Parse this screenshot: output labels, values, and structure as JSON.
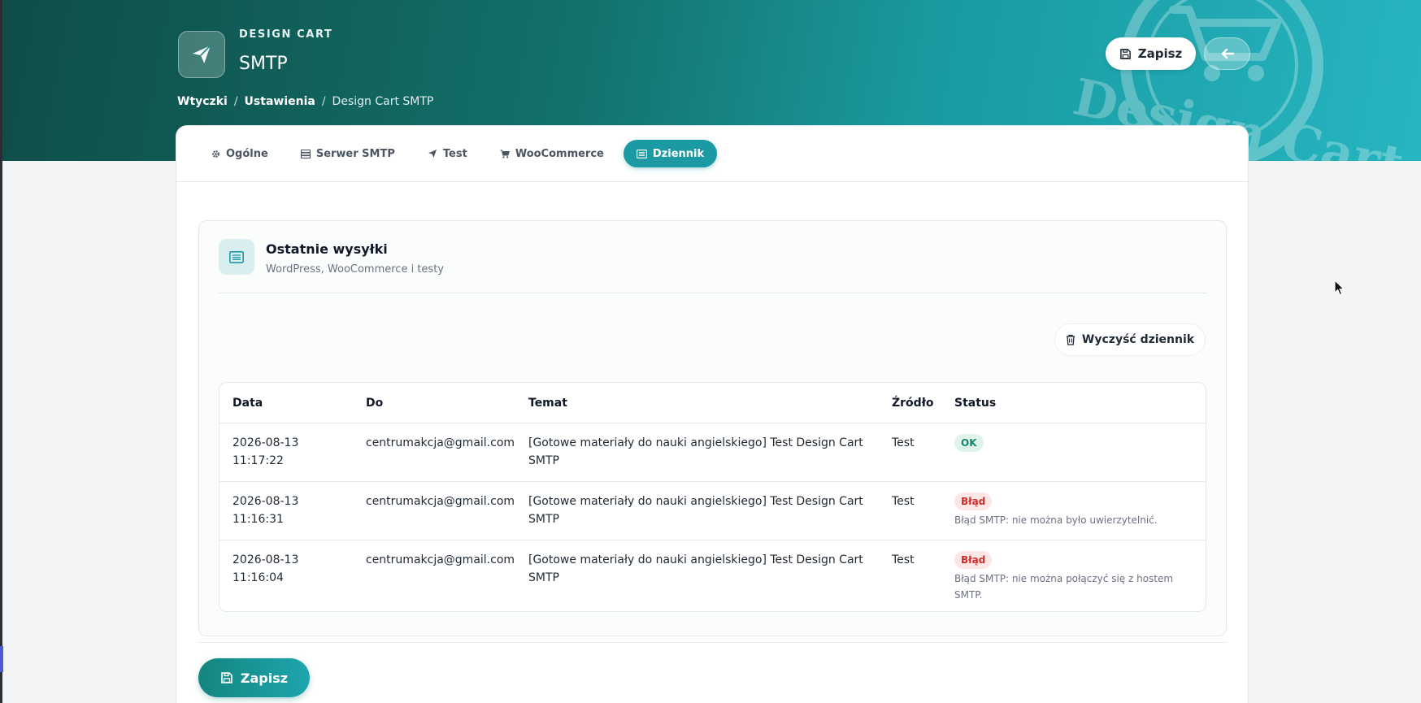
{
  "header": {
    "kicker": "DESIGN CART",
    "title": "SMTP",
    "save_label": "Zapisz",
    "watermark_text": "Design Cart",
    "breadcrumb": [
      {
        "label": "Wtyczki"
      },
      {
        "label": "Ustawienia"
      },
      {
        "label": "Design Cart SMTP"
      }
    ],
    "separator": "/"
  },
  "tabs": [
    {
      "label": "Ogólne",
      "icon": "gear-icon",
      "active": false
    },
    {
      "label": "Serwer SMTP",
      "icon": "server-icon",
      "active": false
    },
    {
      "label": "Test",
      "icon": "send-icon",
      "active": false
    },
    {
      "label": "WooCommerce",
      "icon": "cart-icon",
      "active": false
    },
    {
      "label": "Dziennik",
      "icon": "log-icon",
      "active": true
    }
  ],
  "panel": {
    "title": "Ostatnie wysyłki",
    "subtitle": "WordPress, WooCommerce i testy",
    "clear_label": "Wyczyść dziennik"
  },
  "log_table": {
    "columns": [
      "Data",
      "Do",
      "Temat",
      "Źródło",
      "Status"
    ],
    "rows": [
      {
        "date": "2026-08-13",
        "time": "11:17:22",
        "to": "centrumakcja@gmail.com",
        "subject": "[Gotowe materiały do nauki angielskiego] Test Design Cart SMTP",
        "source": "Test",
        "status": "OK",
        "status_type": "ok",
        "detail": ""
      },
      {
        "date": "2026-08-13",
        "time": "11:16:31",
        "to": "centrumakcja@gmail.com",
        "subject": "[Gotowe materiały do nauki angielskiego] Test Design Cart SMTP",
        "source": "Test",
        "status": "Błąd",
        "status_type": "err",
        "detail": "Błąd SMTP: nie można było uwierzytelnić."
      },
      {
        "date": "2026-08-13",
        "time": "11:16:04",
        "to": "centrumakcja@gmail.com",
        "subject": "[Gotowe materiały do nauki angielskiego] Test Design Cart SMTP",
        "source": "Test",
        "status": "Błąd",
        "status_type": "err",
        "detail": "Błąd SMTP: nie można połączyć się z hostem SMTP."
      }
    ]
  },
  "footer": {
    "save_label": "Zapisz"
  },
  "colors": {
    "accent": "#1c9aa4",
    "ok_text": "#12866b",
    "ok_bg": "#e0f3ea",
    "error_text": "#cf2d2d",
    "error_bg": "#fde6e6"
  }
}
